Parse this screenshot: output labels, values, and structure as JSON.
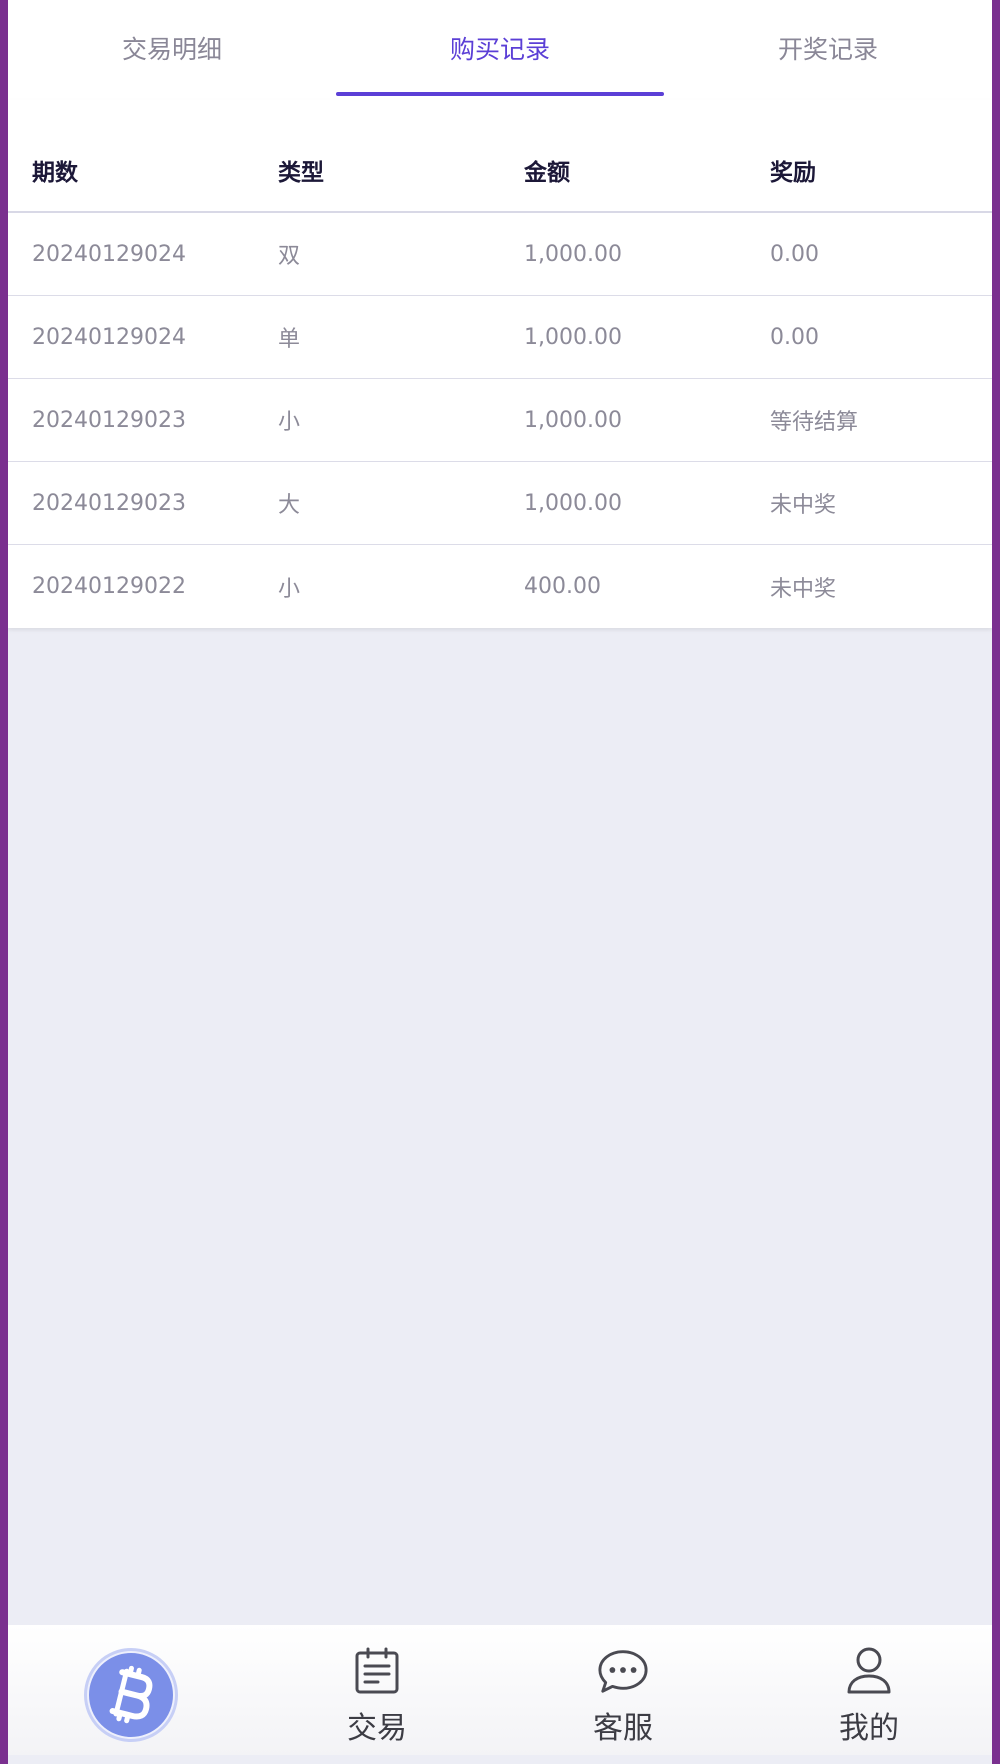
{
  "tabs": [
    {
      "label": "交易明细",
      "active": false
    },
    {
      "label": "购买记录",
      "active": true
    },
    {
      "label": "开奖记录",
      "active": false
    }
  ],
  "table": {
    "headers": [
      "期数",
      "类型",
      "金额",
      "奖励"
    ],
    "rows": [
      [
        "20240129024",
        "双",
        "1,000.00",
        "0.00"
      ],
      [
        "20240129024",
        "单",
        "1,000.00",
        "0.00"
      ],
      [
        "20240129023",
        "小",
        "1,000.00",
        "等待结算"
      ],
      [
        "20240129023",
        "大",
        "1,000.00",
        "未中奖"
      ],
      [
        "20240129022",
        "小",
        "400.00",
        "未中奖"
      ]
    ]
  },
  "bottom_nav": {
    "items": [
      {
        "label": "",
        "icon": "bitcoin-icon"
      },
      {
        "label": "交易",
        "icon": "document-icon"
      },
      {
        "label": "客服",
        "icon": "chat-bubble-icon"
      },
      {
        "label": "我的",
        "icon": "user-icon"
      }
    ]
  },
  "colors": {
    "accent": "#5b3fd6",
    "background": "#ecedf5",
    "text_muted": "#8c8a98",
    "header_text": "#1c1838"
  }
}
